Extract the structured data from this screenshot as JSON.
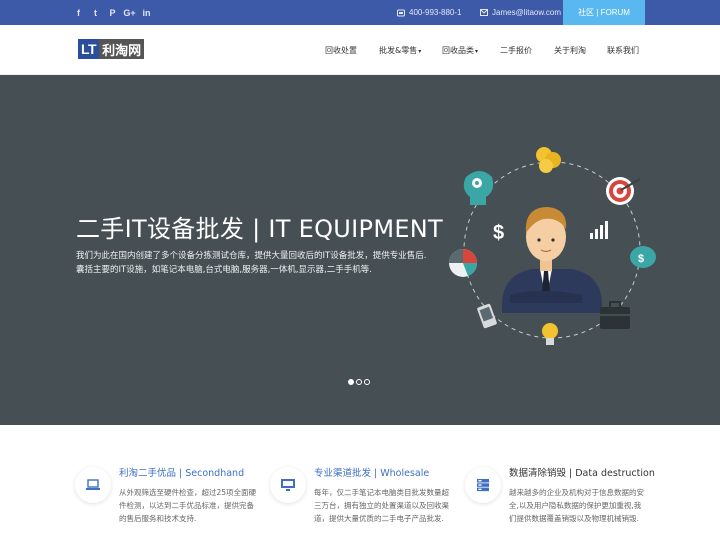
{
  "topbar": {
    "social": [
      {
        "icon": "facebook-icon",
        "glyph": "f"
      },
      {
        "icon": "twitter-icon",
        "glyph": "t"
      },
      {
        "icon": "pinterest-icon",
        "glyph": "P"
      },
      {
        "icon": "google-plus-icon",
        "glyph": "G+"
      },
      {
        "icon": "linkedin-icon",
        "glyph": "in"
      }
    ],
    "phone": "400-993-880-1",
    "email": "James@litaow.com",
    "forum": "社区 | FORUM"
  },
  "header": {
    "logo_it": "LT",
    "logo_cn": "利淘网",
    "nav": [
      {
        "label": "回收处置",
        "caret": false
      },
      {
        "label": "批发&零售",
        "caret": true
      },
      {
        "label": "回收品类",
        "caret": true
      },
      {
        "label": "二手报价",
        "caret": false
      },
      {
        "label": "关于利淘",
        "caret": false
      },
      {
        "label": "联系我们",
        "caret": false
      }
    ]
  },
  "hero": {
    "title": "二手IT设备批发 | IT EQUIPMENT",
    "desc_line1": "我们为此在国内创建了多个设备分拣测试仓库，提供大量回收后的IT设备批发，提供专业售后.",
    "desc_line2": "囊括主要的IT设施，如笔记本电脑,台式电脑,服务器,一体机,显示器,二手手机等.",
    "slide_count": 3,
    "active_slide": 1,
    "colors": {
      "background": "#464f53",
      "accent_red": "#d8453b",
      "accent_teal": "#3aa6a6",
      "accent_gold": "#f2c230"
    }
  },
  "features": [
    {
      "icon": "laptop-icon",
      "title": "利淘二手优品 | Secondhand",
      "desc": "从外观筛选至硬件检查，超过25项全面硬件检测，以达到二手优品标准，提供完备的售后服务和技术支持."
    },
    {
      "icon": "monitor-icon",
      "title": "专业渠道批发 | Wholesale",
      "desc": "每年，仅二手笔记本电脑类目批发数量超三万台，拥有独立的处置渠道以及回收渠道，提供大量优质的二手电子产品批发."
    },
    {
      "icon": "server-icon",
      "title": "数据清除销毁 | Data destruction",
      "desc": "越来越多的企业及机构对于信息数据的安全,以及用户隐私数据的保护更加重视,我们提供数据覆盖销毁以及物理机械销毁."
    }
  ]
}
